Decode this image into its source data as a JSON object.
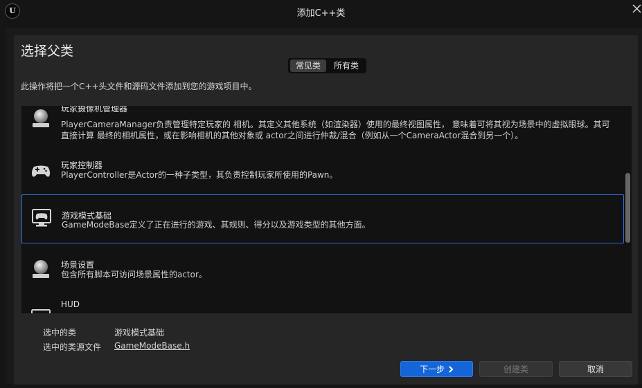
{
  "window": {
    "title": "添加C++类",
    "logo_text": "U"
  },
  "heading": "选择父类",
  "tabs": [
    {
      "label": "常见类",
      "active": true
    },
    {
      "label": "所有类",
      "active": false
    }
  ],
  "description": "此操作将把一个C++头文件和源码文件添加到您的游戏项目中。",
  "classes": [
    {
      "name": "玩家摄像机管理器",
      "icon": "sphere-icon",
      "description": "PlayerCameraManager负责管理特定玩家的 相机。其定义其他系统（如渲染器）使用的最终视图属性， 意味着可将其视为场景中的虚拟眼球。其可直接计算 最终的相机属性，或在影响相机的其他对象或 actor之间进行仲裁/混合（例如从一个CameraActor混合到另一个）。"
    },
    {
      "name": "玩家控制器",
      "icon": "gamepad-icon",
      "description": "PlayerController是Actor的一种子类型，其负责控制玩家所使用的Pawn。"
    },
    {
      "name": "游戏模式基础",
      "icon": "monitor-gamepad-icon",
      "description": "GameModeBase定义了正在进行的游戏、其规则、得分以及游戏类型的其他方面。",
      "selected": true
    },
    {
      "name": "场景设置",
      "icon": "sphere-icon",
      "description": "包含所有脚本可访问场景属性的actor。"
    },
    {
      "name": "HUD",
      "icon": "monitor-icon",
      "description": ""
    }
  ],
  "footer": {
    "selected_class_label": "选中的类",
    "selected_class_value": "游戏模式基础",
    "source_file_label": "选中的类源文件",
    "source_file_value": "GameModeBase.h"
  },
  "buttons": {
    "next": "下一步",
    "create": "创建类",
    "cancel": "取消"
  },
  "colors": {
    "accent": "#1466d8",
    "selection_border": "#2f6fdb",
    "background": "#151515"
  }
}
